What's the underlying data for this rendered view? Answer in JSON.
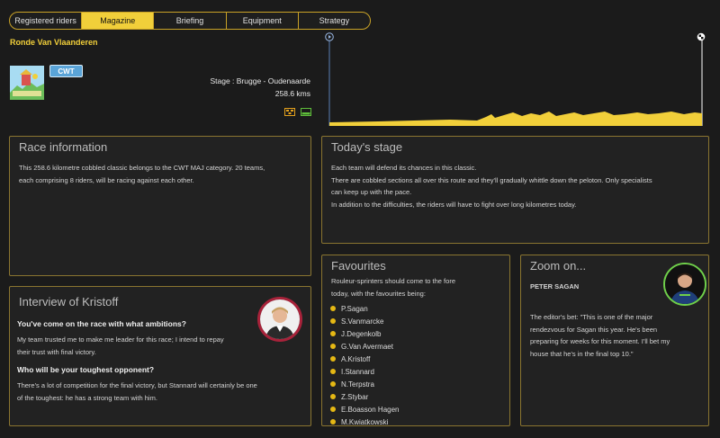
{
  "tabs": [
    {
      "label": "Registered riders",
      "active": false
    },
    {
      "label": "Magazine",
      "active": true
    },
    {
      "label": "Briefing",
      "active": false
    },
    {
      "label": "Equipment",
      "active": false
    },
    {
      "label": "Strategy",
      "active": false
    }
  ],
  "race": {
    "title": "Ronde Van Vlaanderen",
    "category": "CWT",
    "logo_text": "Ronde Van Vlaanderen",
    "stage": "Stage : Brugge - Oudenaarde",
    "distance": "258.6 kms",
    "stage_icons": [
      "cobbles-icon",
      "flat-terrain-icon"
    ]
  },
  "colors": {
    "accent": "#f1cf3a",
    "panel_border": "#8a7530",
    "background": "#1b1b1b",
    "panel_bg": "#222222",
    "badge": "#5aa4d8"
  },
  "race_information": {
    "title": "Race information",
    "lines": [
      "This 258.6 kilometre cobbled classic belongs to the CWT MAJ category. 20 teams,",
      "each comprising 8 riders, will be racing against each other."
    ]
  },
  "todays_stage": {
    "title": "Today's stage",
    "lines": [
      "Each team will defend its chances in this classic.",
      "There are cobbled sections all over this route and they'll gradually whittle down the peloton. Only specialists",
      "can keep up with the pace.",
      "In addition to the difficulties, the riders will have to fight over long kilometres today."
    ]
  },
  "interview": {
    "title": "Interview of Kristoff",
    "q1": "You've come on the race with what ambitions?",
    "a1": [
      "My team trusted me to make me leader for this race; I intend to repay",
      "their trust with final victory."
    ],
    "q2": "Who will be your toughest opponent?",
    "a2": [
      "There's a lot of competition for the final victory, but Stannard will certainly be one",
      "of the toughest: he has a strong team with him."
    ]
  },
  "favourites": {
    "title": "Favourites",
    "intro": [
      "Rouleur-sprinters should come to the fore",
      "today, with the favourites being:"
    ],
    "riders": [
      "P.Sagan",
      "S.Vanmarcke",
      "J.Degenkolb",
      "G.Van Avermaet",
      "A.Kristoff",
      "I.Stannard",
      "N.Terpstra",
      "Z.Stybar",
      "E.Boasson Hagen",
      "M.Kwiatkowski"
    ]
  },
  "zoom": {
    "title": "Zoom on...",
    "rider": "PETER SAGAN",
    "text": [
      "The editor's bet:  \"This is one of the major",
      "rendezvous for Sagan this year. He's been",
      "preparing for weeks for this moment. I'll bet my",
      "house that he's in the final top 10.\""
    ]
  }
}
